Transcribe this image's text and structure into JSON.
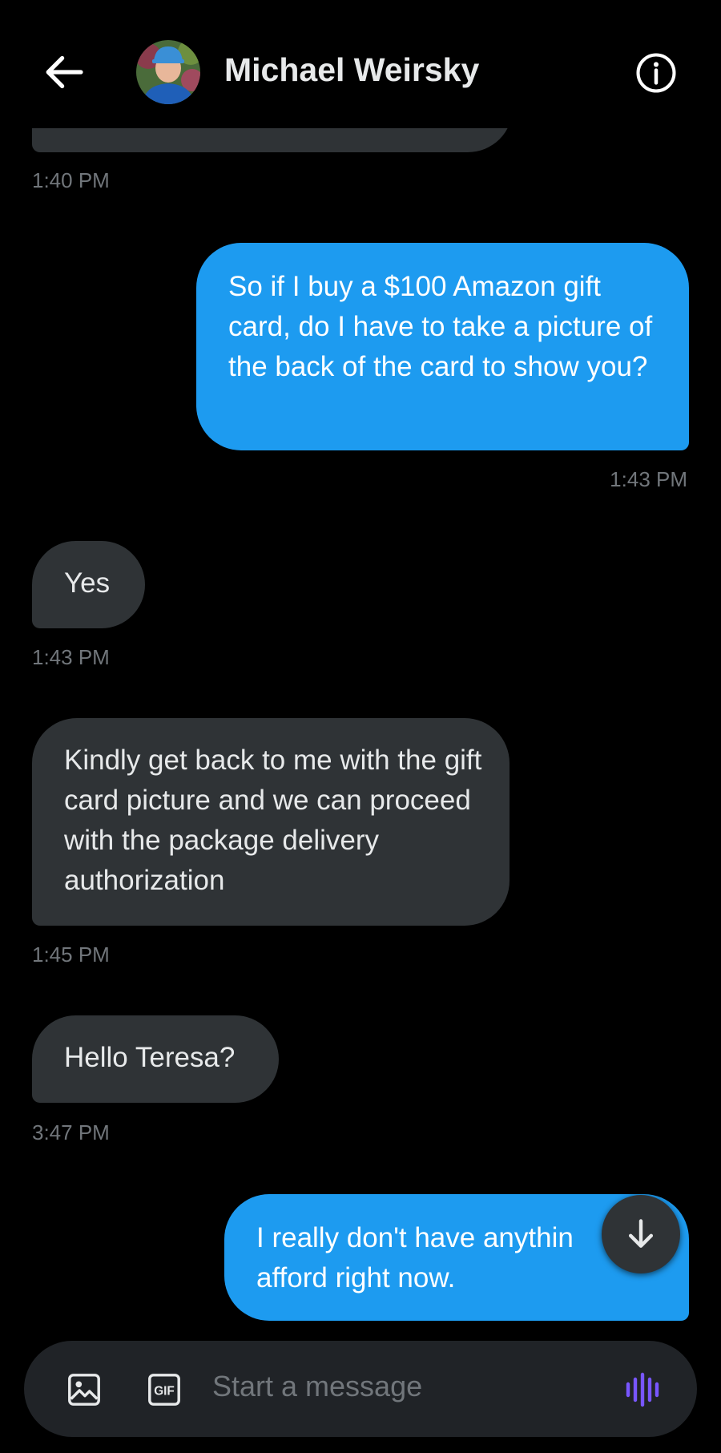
{
  "header": {
    "contact_name": "Michael Weirsky",
    "back_icon": "arrow-left-icon",
    "info_icon": "info-icon"
  },
  "messages": [
    {
      "direction": "incoming",
      "text": "",
      "time": "1:40 PM"
    },
    {
      "direction": "outgoing",
      "text": "So if I buy a $100 Amazon gift card, do I have to take a picture of the back of the card to show you?",
      "time": "1:43 PM"
    },
    {
      "direction": "incoming",
      "text": "Yes",
      "time": "1:43 PM"
    },
    {
      "direction": "incoming",
      "text": "Kindly get back to me with the gift card picture and we can proceed with the package delivery authorization",
      "time": "1:45 PM"
    },
    {
      "direction": "incoming",
      "text": "Hello Teresa?",
      "time": "3:47 PM"
    },
    {
      "direction": "outgoing",
      "text": "I really don't have anythin afford right now.",
      "time": ""
    }
  ],
  "composer": {
    "placeholder": "Start a message",
    "gif_label": "GIF",
    "image_icon": "image-icon",
    "gif_icon": "gif-icon",
    "voice_icon": "voice-waveform-icon"
  },
  "colors": {
    "background": "#000000",
    "incoming_bubble": "#2f3336",
    "outgoing_bubble": "#1d9bf0",
    "timestamp": "#71767b",
    "voice_accent": "#7856ff"
  }
}
